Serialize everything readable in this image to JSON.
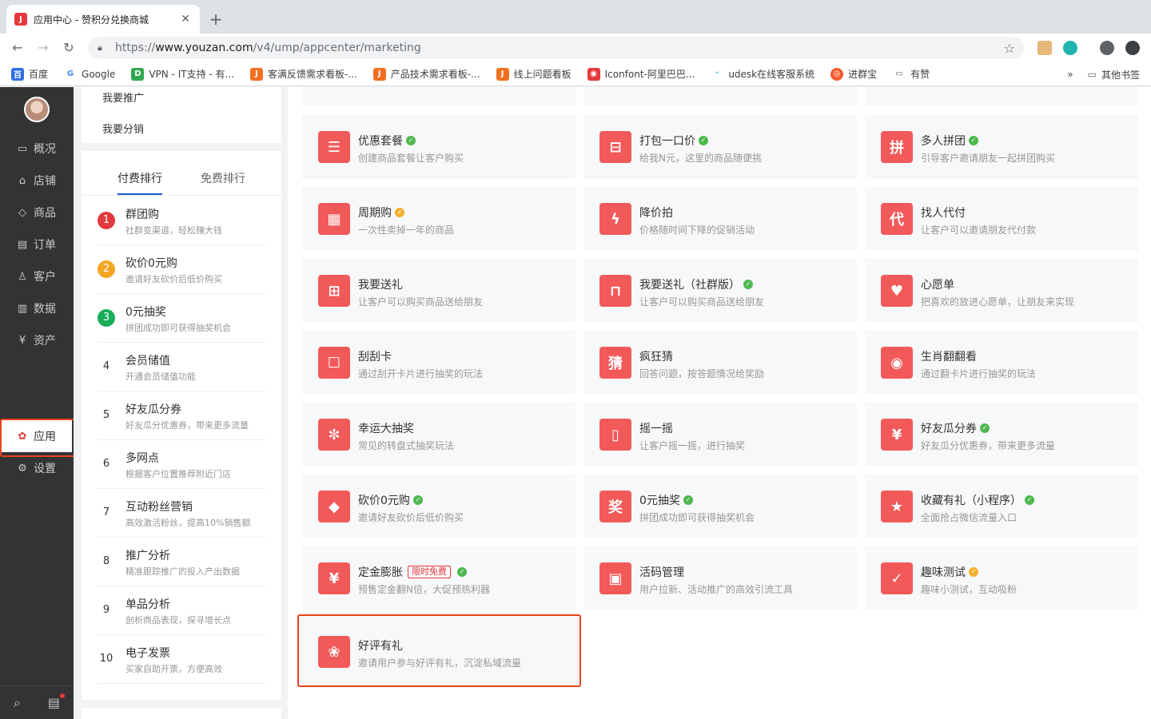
{
  "browser": {
    "tab_title": "应用中心 - 赞积分兑换商城",
    "tab_favicon": "J",
    "url_prefix": "https://",
    "url_host": "www.youzan.com",
    "url_path": "/v4/ump/appcenter/marketing",
    "bookmarks": [
      "百度",
      "Google",
      "VPN - IT支持 - 有...",
      "客满反馈需求看板-...",
      "产品技术需求看板-...",
      "线上问题看板",
      "Iconfont-阿里巴巴...",
      "udesk在线客服系统",
      "进群宝",
      "有赞"
    ],
    "bookmarks_more": "»",
    "other_bookmarks": "其他书签"
  },
  "leftnav": {
    "items": [
      {
        "label": "概况",
        "icon": "monitor-icon"
      },
      {
        "label": "店铺",
        "icon": "store-icon"
      },
      {
        "label": "商品",
        "icon": "tag-icon"
      },
      {
        "label": "订单",
        "icon": "document-icon"
      },
      {
        "label": "客户",
        "icon": "user-icon"
      },
      {
        "label": "数据",
        "icon": "bar-chart-icon"
      },
      {
        "label": "资产",
        "icon": "yen-icon"
      }
    ],
    "active": {
      "label": "应用",
      "icon": "apps-icon"
    },
    "settings": {
      "label": "设置",
      "icon": "gear-icon"
    }
  },
  "secondary": {
    "links": [
      "我要推广",
      "我要分销"
    ],
    "tabs": [
      "付费排行",
      "免费排行"
    ],
    "ranking": [
      {
        "num": "1",
        "title": "群团购",
        "desc": "社群变渠道，轻松赚大钱",
        "color": "#e4393c"
      },
      {
        "num": "2",
        "title": "砍价0元购",
        "desc": "邀请好友砍价后低价购买",
        "color": "#f5a623"
      },
      {
        "num": "3",
        "title": "0元抽奖",
        "desc": "拼团成功即可获得抽奖机会",
        "color": "#1aad5a"
      },
      {
        "num": "4",
        "title": "会员储值",
        "desc": "开通会员储值功能"
      },
      {
        "num": "5",
        "title": "好友瓜分券",
        "desc": "好友瓜分优惠券，带来更多流量"
      },
      {
        "num": "6",
        "title": "多网点",
        "desc": "根据客户位置推荐附近门店"
      },
      {
        "num": "7",
        "title": "互动粉丝营销",
        "desc": "高效激活粉丝，提高10%销售额"
      },
      {
        "num": "8",
        "title": "推广分析",
        "desc": "精准跟踪推广的投入产出数据"
      },
      {
        "num": "9",
        "title": "单品分析",
        "desc": "剖析商品表现，探寻增长点"
      },
      {
        "num": "10",
        "title": "电子发票",
        "desc": "买家自助开票，方便高效"
      }
    ]
  },
  "cards": [
    {
      "title": "优惠套餐",
      "desc": "创建商品套餐让客户购买",
      "icon": "list-icon",
      "glyph": "☰",
      "badge": "g"
    },
    {
      "title": "打包一口价",
      "desc": "给我N元，这里的商品随便挑",
      "icon": "basket-icon",
      "glyph": "⊟",
      "badge": "g"
    },
    {
      "title": "多人拼团",
      "desc": "引导客户邀请朋友一起拼团购买",
      "icon": "pin-icon",
      "glyph": "拼",
      "badge": "g"
    },
    {
      "title": "周期购",
      "desc": "一次性卖掉一年的商品",
      "icon": "calendar-icon",
      "glyph": "▦",
      "badge": "y"
    },
    {
      "title": "降价拍",
      "desc": "价格随时间下降的促销活动",
      "icon": "lightning-icon",
      "glyph": "ϟ",
      "badge": ""
    },
    {
      "title": "找人代付",
      "desc": "让客户可以邀请朋友代付款",
      "icon": "daifu-icon",
      "glyph": "代",
      "badge": ""
    },
    {
      "title": "我要送礼",
      "desc": "让客户可以购买商品送给朋友",
      "icon": "gift-icon",
      "glyph": "⊞",
      "badge": ""
    },
    {
      "title": "我要送礼（社群版）",
      "desc": "让客户可以购买商品送给朋友",
      "icon": "group-gift-icon",
      "glyph": "⊓",
      "badge": "g"
    },
    {
      "title": "心愿单",
      "desc": "把喜欢的放进心愿单，让朋友来实现",
      "icon": "heart-icon",
      "glyph": "♥",
      "badge": ""
    },
    {
      "title": "刮刮卡",
      "desc": "通过刮开卡片进行抽奖的玩法",
      "icon": "scratch-card-icon",
      "glyph": "☐",
      "badge": ""
    },
    {
      "title": "疯狂猜",
      "desc": "回答问题，按答题情况给奖励",
      "icon": "guess-icon",
      "glyph": "猜",
      "badge": ""
    },
    {
      "title": "生肖翻翻看",
      "desc": "通过翻卡片进行抽奖的玩法",
      "icon": "zodiac-icon",
      "glyph": "◉",
      "badge": ""
    },
    {
      "title": "幸运大抽奖",
      "desc": "常见的转盘式抽奖玩法",
      "icon": "wheel-icon",
      "glyph": "✼",
      "badge": ""
    },
    {
      "title": "摇一摇",
      "desc": "让客户摇一摇，进行抽奖",
      "icon": "shake-icon",
      "glyph": "▯",
      "badge": ""
    },
    {
      "title": "好友瓜分券",
      "desc": "好友瓜分优惠券，带来更多流量",
      "icon": "coupon-icon",
      "glyph": "¥",
      "badge": "g"
    },
    {
      "title": "砍价0元购",
      "desc": "邀请好友砍价后低价购买",
      "icon": "cut-price-icon",
      "glyph": "◆",
      "badge": "g"
    },
    {
      "title": "0元抽奖",
      "desc": "拼团成功即可获得抽奖机会",
      "icon": "prize-icon",
      "glyph": "奖",
      "badge": "g"
    },
    {
      "title": "收藏有礼（小程序）",
      "desc": "全面抢占微信流量入口",
      "icon": "favorite-icon",
      "glyph": "★",
      "badge": "g"
    },
    {
      "title": "定金膨胀",
      "desc": "预售定金翻N倍，大促预热利器",
      "icon": "deposit-icon",
      "glyph": "¥",
      "badge": "g",
      "tag": "限时免费"
    },
    {
      "title": "活码管理",
      "desc": "用户拉新、活动推广的高效引流工具",
      "icon": "qrcode-icon",
      "glyph": "▣",
      "badge": ""
    },
    {
      "title": "趣味测试",
      "desc": "趣味小测试，互动吸粉",
      "icon": "quiz-icon",
      "glyph": "✓",
      "badge": "y"
    },
    {
      "title": "好评有礼",
      "desc": "邀请用户参与好评有礼，沉淀私域流量",
      "icon": "flower-icon",
      "glyph": "❀",
      "badge": ""
    }
  ]
}
